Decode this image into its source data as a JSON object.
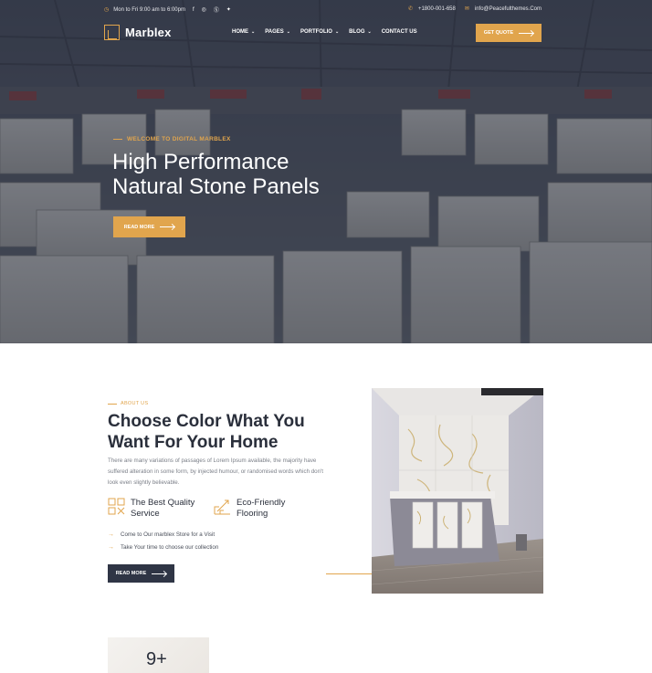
{
  "topbar": {
    "hours": "Mon to Fri 9:00 am to 6:00pm",
    "phone": "+1800-001-658",
    "email": "info@Peacefulthemes.Com",
    "social_icons": [
      "facebook-icon",
      "instagram-icon",
      "skype-icon",
      "twitter-icon"
    ]
  },
  "nav": {
    "brand": "Marblex",
    "items": [
      {
        "label": "HOME",
        "has_dropdown": true
      },
      {
        "label": "PAGES",
        "has_dropdown": true
      },
      {
        "label": "PORTFOLIO",
        "has_dropdown": true
      },
      {
        "label": "BLOG",
        "has_dropdown": true
      },
      {
        "label": "CONTACT US",
        "has_dropdown": false
      }
    ],
    "cta": "GET QUOTE"
  },
  "hero": {
    "subtitle": "WELCOME TO DIGITAL MARBLEX",
    "title_line1": "High Performance",
    "title_line2": "Natural Stone Panels",
    "button": "READ MORE"
  },
  "about": {
    "subtitle": "ABOUT US",
    "title_line1": "Choose Color What You",
    "title_line2": "Want For Your Home",
    "text": "There are many variations of passages of Lorem Ipsum available, the majority have suffered alteration in some form, by injected humour, or randomised words which don't look even slightly believable.",
    "features": [
      {
        "icon": "quality-icon",
        "label_line1": "The Best Quality",
        "label_line2": "Service"
      },
      {
        "icon": "eco-flooring-icon",
        "label_line1": "Eco-Friendly",
        "label_line2": "Flooring"
      }
    ],
    "checklist": [
      "Come to Our marblex Store for a Visit",
      "Take Your time to choose our collection"
    ],
    "button": "READ MORE"
  },
  "stats": {
    "number": "9+"
  },
  "colors": {
    "accent": "#e1a54d",
    "dark": "#2f3545",
    "text_muted": "#7b7f88"
  }
}
